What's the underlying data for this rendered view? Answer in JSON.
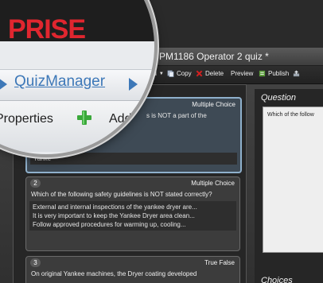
{
  "brand": "PRISE",
  "breadcrumb": {
    "link": "QuizManager",
    "title": "PM1186 Operator 2 quiz *"
  },
  "toolbar": {
    "properties": "Properties",
    "add": "Add",
    "add_small": "dd",
    "copy": "Copy",
    "delete": "Delete",
    "preview": "Preview",
    "publish": "Publish"
  },
  "questions": [
    {
      "number": "",
      "type": "Multiple Choice",
      "text": "s is NOT a part of the",
      "choice_fragment": "Yanke"
    },
    {
      "number": "2",
      "type": "Multiple Choice",
      "text": "Which of the following safety guidelines is NOT stated correctly?",
      "choices": [
        "External and internal inspections of the yankee dryer are...",
        "It is very important to keep the Yankee Dryer area clean...",
        "Follow approved procedures for warming up, cooling..."
      ]
    },
    {
      "number": "3",
      "type": "True False",
      "text": "On original Yankee machines, the Dryer coating developed"
    }
  ],
  "editor": {
    "question_label": "Question",
    "question_text": "Which of the follow",
    "choices_label": "Choices"
  },
  "colors": {
    "brand_red": "#e0262f",
    "link_blue": "#3d78b8",
    "add_green": "#3aa83a",
    "delete_red": "#d32020"
  }
}
